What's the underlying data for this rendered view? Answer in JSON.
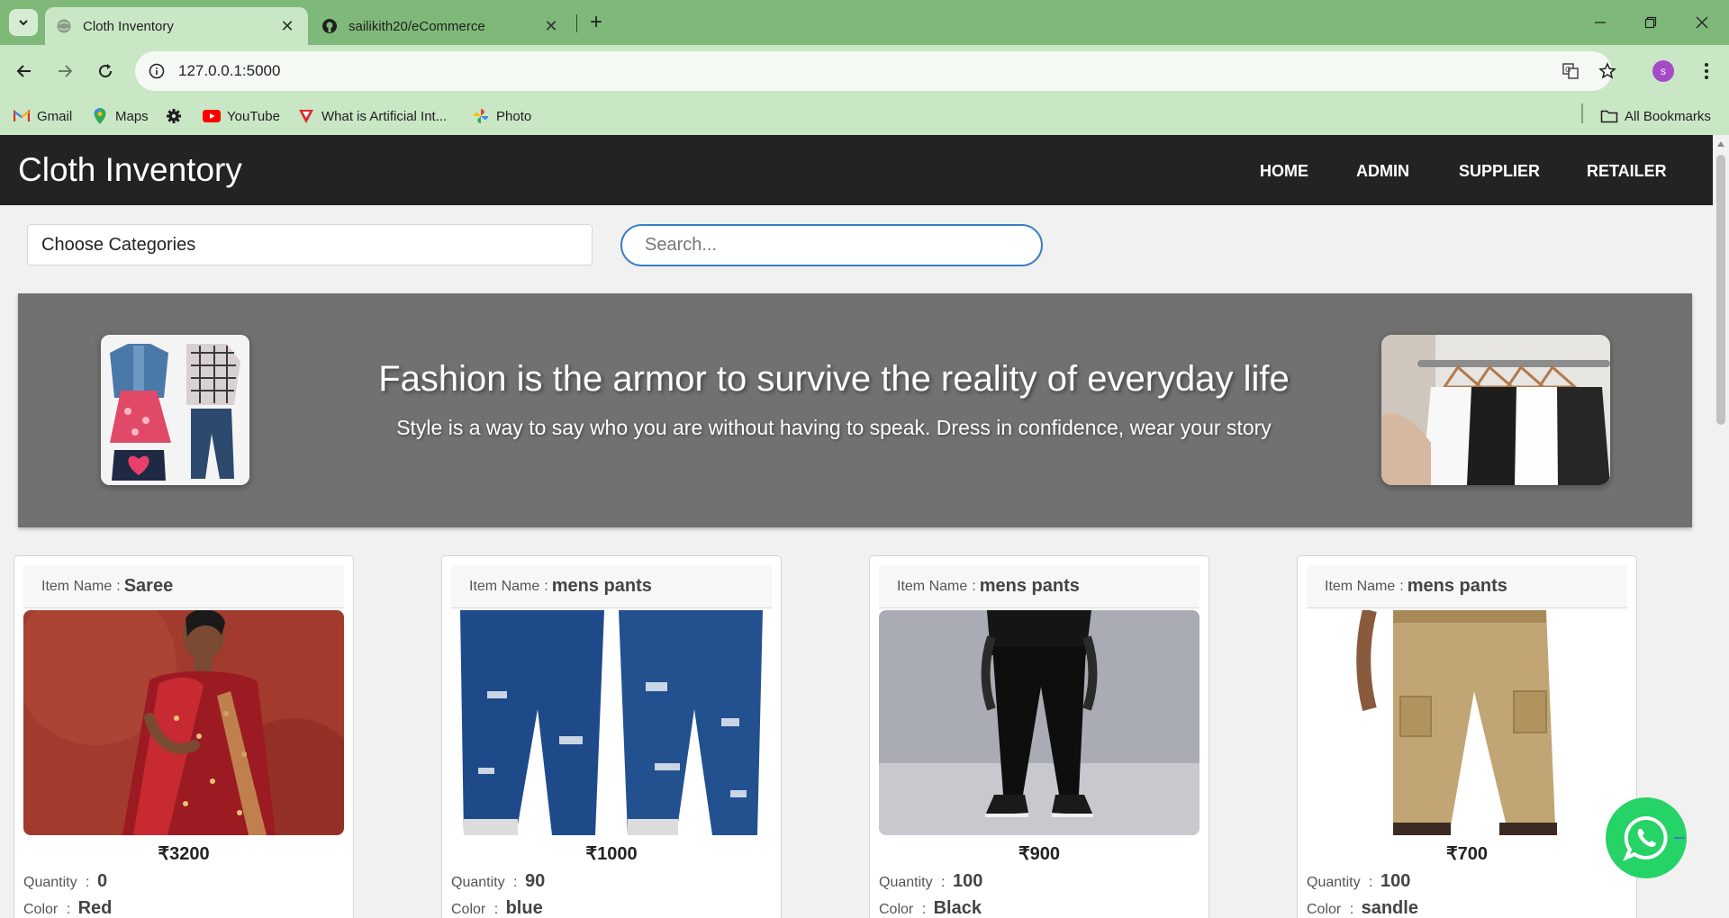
{
  "browser": {
    "tabs": [
      {
        "title": "Cloth Inventory",
        "active": true
      },
      {
        "title": "sailikith20/eCommerce",
        "active": false
      }
    ],
    "url": "127.0.0.1:5000",
    "profile_initial": "s",
    "bookmarks": [
      {
        "label": "Gmail",
        "icon": "gmail-icon"
      },
      {
        "label": "Maps",
        "icon": "maps-icon"
      },
      {
        "label": "",
        "icon": "gear-icon"
      },
      {
        "label": "YouTube",
        "icon": "youtube-icon"
      },
      {
        "label": "What is Artificial Int...",
        "icon": "v-logo-icon"
      },
      {
        "label": "Photo",
        "icon": "pinwheel-icon"
      }
    ],
    "all_bookmarks": "All Bookmarks"
  },
  "navbar": {
    "brand": "Cloth Inventory",
    "links": [
      "HOME",
      "ADMIN",
      "SUPPLIER",
      "RETAILER"
    ]
  },
  "filters": {
    "category_label": "Choose Categories",
    "search_placeholder": "Search..."
  },
  "banner": {
    "title": "Fashion is the armor to survive the reality of everyday life",
    "subtitle": "Style is a way to say who you are without having to speak. Dress in confidence, wear your story"
  },
  "labels": {
    "item_name": "Item Name",
    "quantity": "Quantity",
    "color": "Color",
    "separator": ":"
  },
  "items": [
    {
      "name": "Saree",
      "price": "₹3200",
      "quantity": "0",
      "color": "Red"
    },
    {
      "name": "mens pants",
      "price": "₹1000",
      "quantity": "90",
      "color": "blue"
    },
    {
      "name": "mens pants",
      "price": "₹900",
      "quantity": "100",
      "color": "Black"
    },
    {
      "name": "mens pants",
      "price": "₹700",
      "quantity": "100",
      "color": "sandle"
    }
  ],
  "colors": {
    "tab_bar": "#7fb97a",
    "toolbar": "#c9e6c5",
    "navbar": "#232323",
    "banner": "#717171",
    "search_border": "#3b7dc4",
    "whatsapp": "#25d366"
  }
}
